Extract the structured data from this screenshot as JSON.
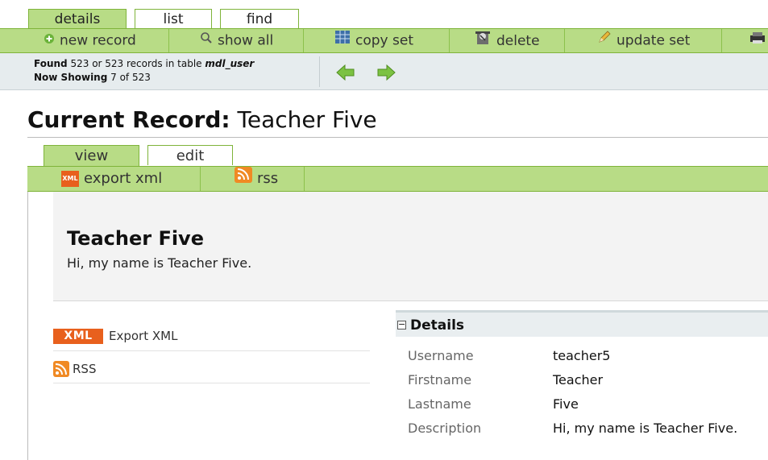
{
  "top_tabs": [
    "details",
    "list",
    "find"
  ],
  "toolbar": {
    "new_record": "new record",
    "show_all": "show all",
    "copy_set": "copy set",
    "delete": "delete",
    "update_set": "update set"
  },
  "found": {
    "prefix": "Found",
    "count_text": "523 or 523 records in table",
    "table": "mdl_user",
    "showing_prefix": "Now Showing",
    "showing_text": "7 of 523"
  },
  "record": {
    "heading_label": "Current Record:",
    "heading_name": "Teacher Five"
  },
  "sub_tabs": [
    "view",
    "edit"
  ],
  "subbar": {
    "export_xml": "export xml",
    "rss": "rss",
    "xml_icon_text": "XML"
  },
  "summary": {
    "name": "Teacher Five",
    "description": "Hi, my name is Teacher Five."
  },
  "links": {
    "xml_badge": "XML",
    "export_xml": "Export XML",
    "rss": "RSS"
  },
  "details": {
    "toggle": "−",
    "title": "Details",
    "rows": [
      {
        "label": "Username",
        "value": "teacher5"
      },
      {
        "label": "Firstname",
        "value": "Teacher"
      },
      {
        "label": "Lastname",
        "value": "Five"
      },
      {
        "label": "Description",
        "value": "Hi, my name is Teacher Five."
      }
    ]
  },
  "colors": {
    "accent_green": "#b8dc86",
    "border_green": "#7fb43a",
    "info_bar": "#e6ecee",
    "rss_orange": "#f08a24",
    "xml_orange": "#e8601d"
  }
}
